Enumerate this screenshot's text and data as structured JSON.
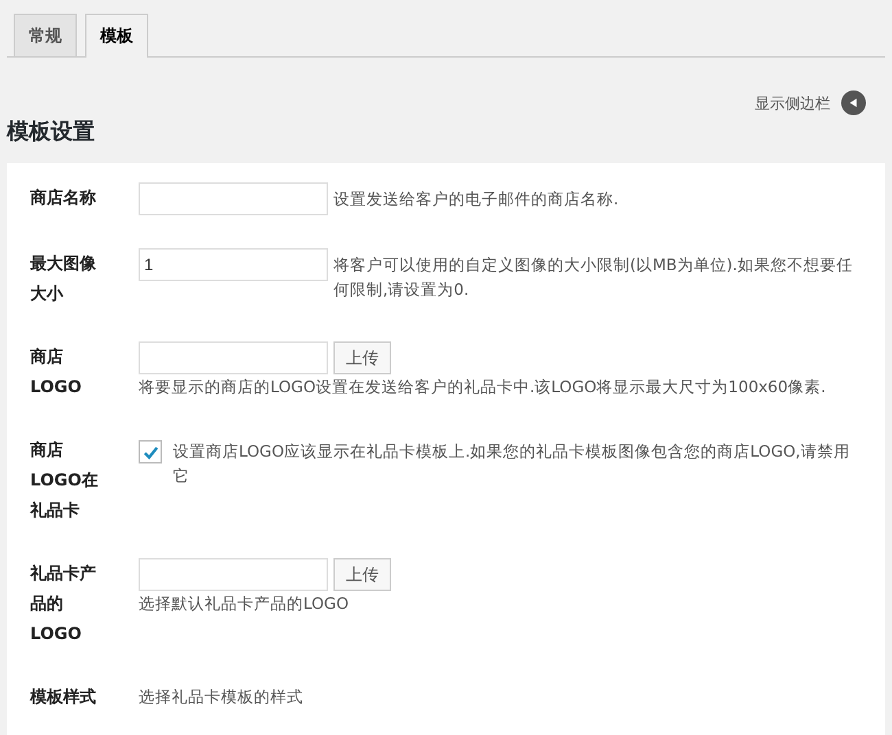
{
  "tabs": [
    {
      "label": "常规",
      "selected": false
    },
    {
      "label": "模板",
      "selected": true
    }
  ],
  "sidebar_toggle": {
    "label": "显示侧边栏"
  },
  "heading": "模板设置",
  "settings": [
    {
      "kind": "text",
      "label": "商店名称",
      "description": "设置发送给客户的电子邮件的商店名称."
    },
    {
      "kind": "text",
      "label": "最大图像大小",
      "value": "1",
      "description": "将客户可以使用的自定义图像的大小限制(以MB为单位).如果您不想要任何限制,请设置为0."
    },
    {
      "kind": "upload",
      "label": "商店LOGO",
      "button": "上传",
      "description": "将要显示的商店的LOGO设置在发送给客户的礼品卡中.该LOGO将显示最大尺寸为100x60像素."
    },
    {
      "kind": "checkbox",
      "label": "商店LOGO在礼品卡",
      "checked": true,
      "description": "设置商店LOGO应该显示在礼品卡模板上.如果您的礼品卡模板图像包含您的商店LOGO,请禁用它"
    },
    {
      "kind": "upload",
      "label": "礼品卡产品的LOGO",
      "button": "上传",
      "description": "选择默认礼品卡产品的LOGO"
    },
    {
      "kind": "note",
      "label": "模板样式",
      "description": "选择礼品卡模板的样式"
    }
  ]
}
